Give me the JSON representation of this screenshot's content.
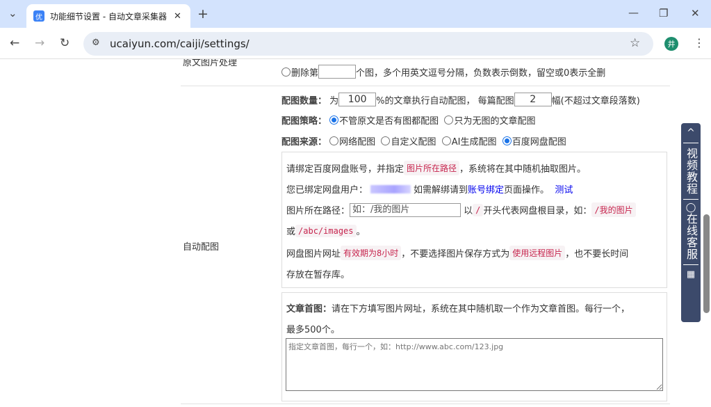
{
  "browser": {
    "tab_title": "功能细节设置 - 自动文章采集器",
    "favicon": "优",
    "url": "ucaiyun.com/caiji/settings/",
    "profile": "井"
  },
  "rows": {
    "original_image": {
      "label": "原文图片处理",
      "delete_prefix": "删除第",
      "delete_value": "",
      "delete_suffix": "个图，多个用英文逗号分隔，负数表示倒数，留空或0表示全删"
    },
    "auto_image": {
      "label": "自动配图",
      "count_label": "配图数量：",
      "count_pre": "为",
      "percent": "100",
      "count_mid": "%的文章执行自动配图， 每篇配图",
      "per_article": "2",
      "count_suffix": "幅(不超过文章段落数)",
      "strategy_label": "配图策略：",
      "strategy_options": [
        "不管原文是否有图都配图",
        "只为无图的文章配图"
      ],
      "strategy_selected": 0,
      "source_label": "配图来源：",
      "source_options": [
        "网络配图",
        "自定义配图",
        "AI生成配图",
        "百度网盘配图"
      ],
      "source_selected": 3,
      "baidu": {
        "l1a": "请绑定百度网盘账号，并指定",
        "l1code": "图片所在路径",
        "l1b": "，系统将在其中随机抽取图片。",
        "l2a": "您已绑定网盘用户：",
        "l2b": "如需解绑请到",
        "l2link": "账号绑定",
        "l2c": "页面操作。",
        "test": "测试",
        "l3a": "图片所在路径：",
        "path_placeholder": "如：/我的图片",
        "l3b": "以",
        "l3code1": "/",
        "l3c": "开头代表网盘根目录，如：",
        "l3code2": "/我的图片",
        "l4a": "或",
        "l4code": "/abc/images",
        "l4b": "。",
        "l5a": "网盘图片网址",
        "l5code1": "有效期为8小时",
        "l5b": "，不要选择图片保存方式为",
        "l5code2": "使用远程图片",
        "l5c": "，也不要长时间",
        "l6": "存放在暂存库。"
      },
      "cover": {
        "label": "文章首图：",
        "text1": "请在下方填写图片网址，系统在其中随机取一个作为文章首图。每行一个，",
        "text2": "最多500个。",
        "placeholder": "指定文章首图，每行一个，如：http://www.abc.com/123.jpg"
      }
    }
  },
  "float_bar": {
    "top": "^",
    "video": "视频教程",
    "service": "在线客服"
  }
}
